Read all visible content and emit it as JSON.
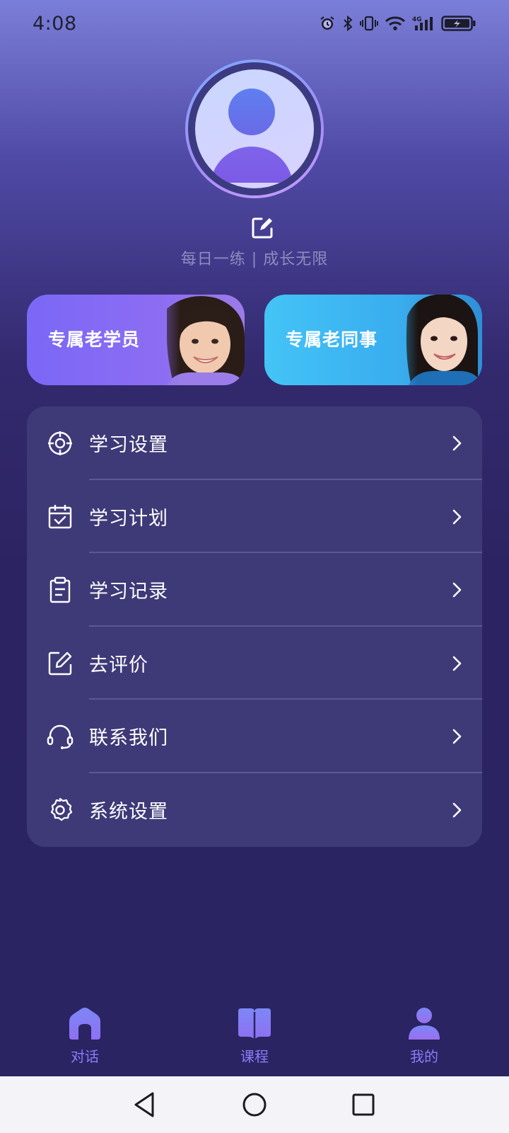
{
  "status_bar": {
    "time": "4:08",
    "icons": [
      "alarm-icon",
      "bluetooth-icon",
      "vibrate-icon",
      "wifi-icon",
      "signal-4g-icon",
      "battery-charging-icon"
    ],
    "network_label": "4G"
  },
  "profile": {
    "avatar_icon": "default-user-avatar",
    "edit_icon": "edit-icon",
    "slogan": "每日一练 | 成长无限"
  },
  "cards": [
    {
      "label": "专属老学员",
      "color": "#7a68f6",
      "image": "smiling-girl-photo"
    },
    {
      "label": "专属老同事",
      "color": "#44c4f6",
      "image": "smiling-woman-photo"
    }
  ],
  "menu": {
    "items": [
      {
        "label": "学习设置",
        "icon": "target-icon"
      },
      {
        "label": "学习计划",
        "icon": "calendar-check-icon"
      },
      {
        "label": "学习记录",
        "icon": "clipboard-icon"
      },
      {
        "label": "去评价",
        "icon": "edit-note-icon"
      },
      {
        "label": "联系我们",
        "icon": "headset-icon"
      },
      {
        "label": "系统设置",
        "icon": "gear-icon"
      }
    ]
  },
  "tabbar": {
    "tabs": [
      {
        "label": "对话",
        "icon": "home-icon"
      },
      {
        "label": "课程",
        "icon": "book-icon"
      },
      {
        "label": "我的",
        "icon": "user-icon",
        "active": true
      }
    ],
    "accent": "#8a7cf6"
  },
  "system_nav": [
    "back-icon",
    "home-circle-icon",
    "recents-icon"
  ]
}
